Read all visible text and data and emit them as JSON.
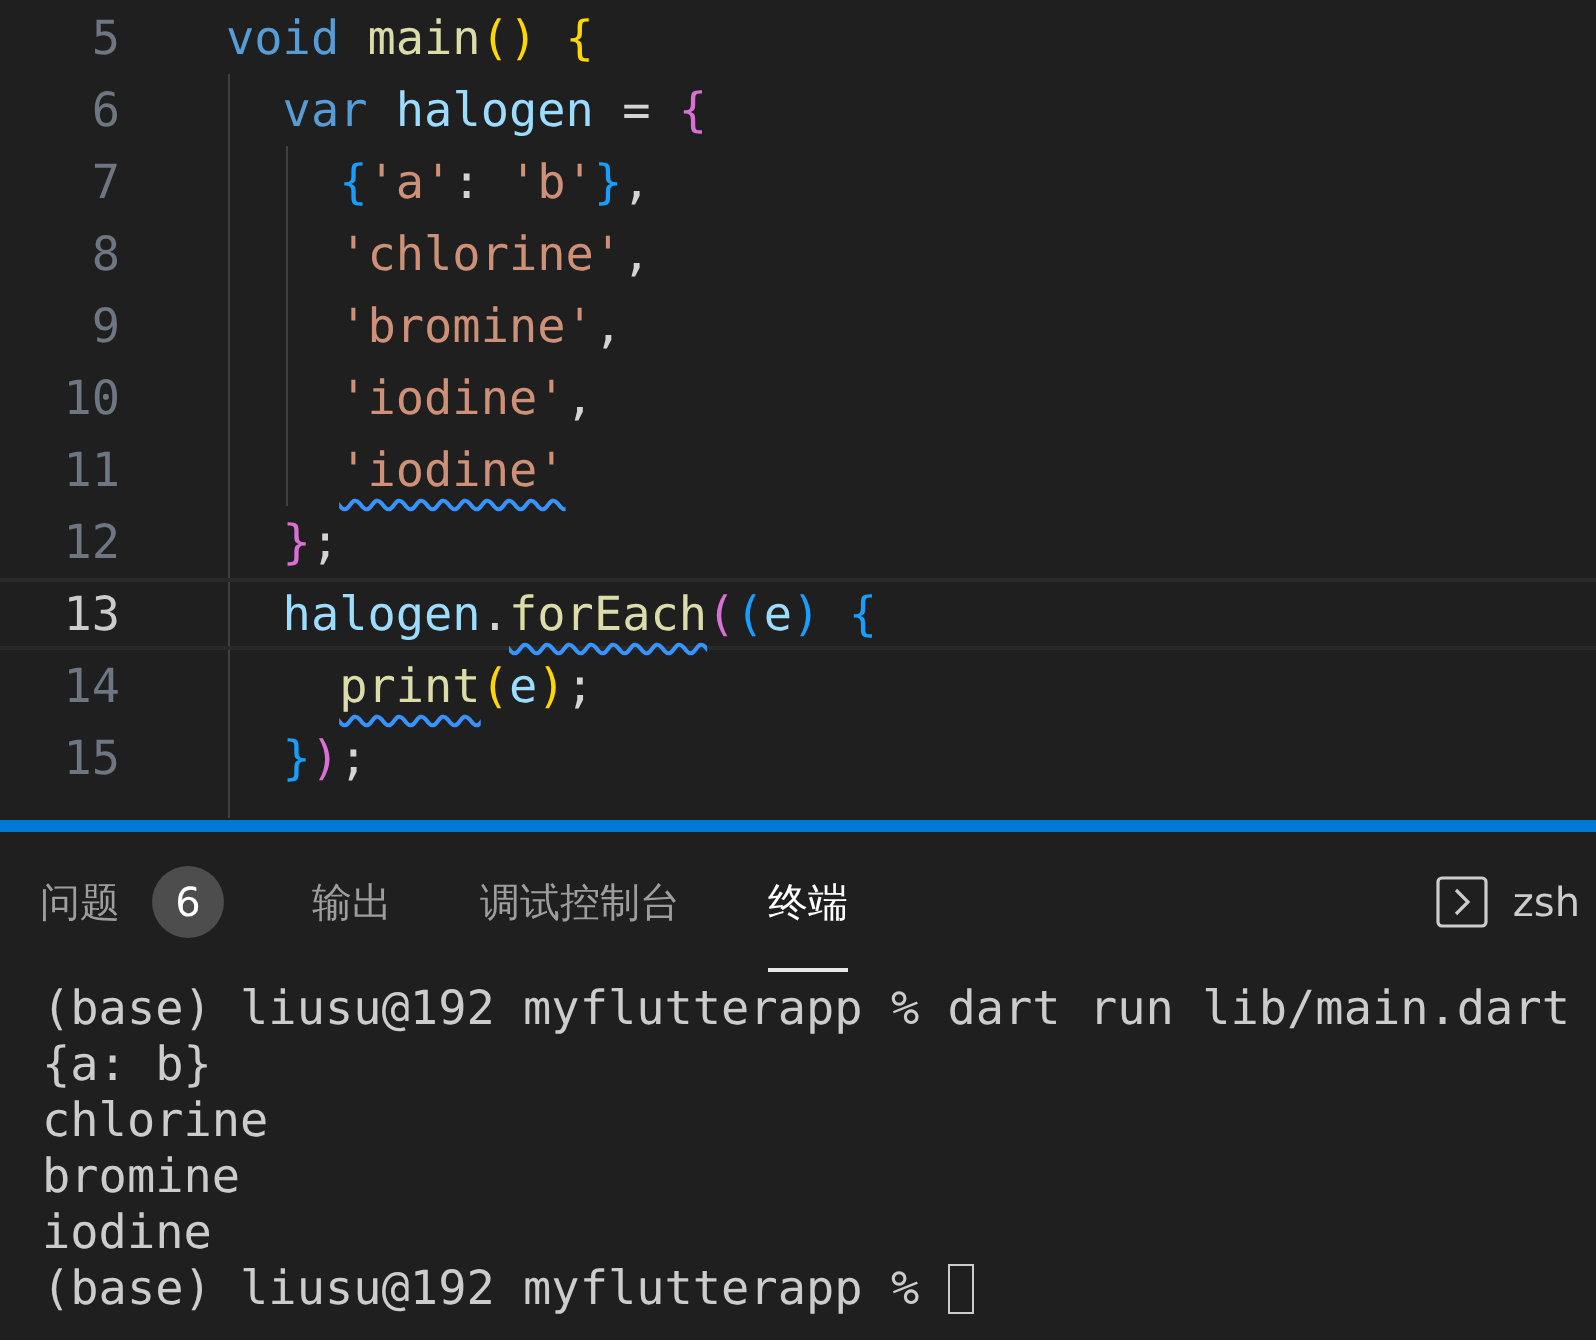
{
  "editor": {
    "lines": [
      {
        "number": "5",
        "current": false,
        "tokens": [
          {
            "text": "void",
            "kind": "keyword"
          },
          {
            "text": " main",
            "kind": "function"
          },
          {
            "text": "()",
            "kind": "bracket1"
          },
          {
            "text": " {",
            "kind": "bracket1"
          }
        ]
      },
      {
        "number": "6",
        "current": false,
        "tokens": [
          {
            "text": "  var",
            "kind": "keyword"
          },
          {
            "text": " halogen",
            "kind": "variable"
          },
          {
            "text": " = ",
            "kind": "punct"
          },
          {
            "text": "{",
            "kind": "bracket2"
          }
        ]
      },
      {
        "number": "7",
        "current": false,
        "tokens": [
          {
            "text": "    {",
            "kind": "bracket3"
          },
          {
            "text": "'a'",
            "kind": "string"
          },
          {
            "text": ": ",
            "kind": "punct"
          },
          {
            "text": "'b'",
            "kind": "string"
          },
          {
            "text": "}",
            "kind": "bracket3"
          },
          {
            "text": ",",
            "kind": "punct"
          }
        ]
      },
      {
        "number": "8",
        "current": false,
        "tokens": [
          {
            "text": "    'chlorine'",
            "kind": "string"
          },
          {
            "text": ",",
            "kind": "punct"
          }
        ]
      },
      {
        "number": "9",
        "current": false,
        "tokens": [
          {
            "text": "    'bromine'",
            "kind": "string"
          },
          {
            "text": ",",
            "kind": "punct"
          }
        ]
      },
      {
        "number": "10",
        "current": false,
        "tokens": [
          {
            "text": "    'iodine'",
            "kind": "string"
          },
          {
            "text": ",",
            "kind": "punct"
          }
        ]
      },
      {
        "number": "11",
        "current": false,
        "tokens": [
          {
            "text": "    'iodine'",
            "kind": "string",
            "warning": true
          }
        ]
      },
      {
        "number": "12",
        "current": false,
        "tokens": [
          {
            "text": "  }",
            "kind": "bracket2"
          },
          {
            "text": ";",
            "kind": "punct"
          }
        ]
      },
      {
        "number": "13",
        "current": true,
        "tokens": [
          {
            "text": "  halogen",
            "kind": "variable"
          },
          {
            "text": ".",
            "kind": "punct"
          },
          {
            "text": "forEach",
            "kind": "function",
            "warning": true
          },
          {
            "text": "(",
            "kind": "bracket2"
          },
          {
            "text": "(",
            "kind": "bracket3"
          },
          {
            "text": "e",
            "kind": "variable"
          },
          {
            "text": ")",
            "kind": "bracket3"
          },
          {
            "text": " {",
            "kind": "bracket3"
          }
        ]
      },
      {
        "number": "14",
        "current": false,
        "tokens": [
          {
            "text": "    print",
            "kind": "function",
            "warning": true
          },
          {
            "text": "(",
            "kind": "bracket1"
          },
          {
            "text": "e",
            "kind": "variable"
          },
          {
            "text": ")",
            "kind": "bracket1"
          },
          {
            "text": ";",
            "kind": "punct"
          }
        ]
      },
      {
        "number": "15",
        "current": false,
        "tokens": [
          {
            "text": "  }",
            "kind": "bracket3"
          },
          {
            "text": ")",
            "kind": "bracket2"
          },
          {
            "text": ";",
            "kind": "punct"
          }
        ]
      }
    ]
  },
  "panel": {
    "tabs": [
      {
        "label": "问题",
        "badge": "6",
        "selected": false
      },
      {
        "label": "输出",
        "selected": false
      },
      {
        "label": "调试控制台",
        "selected": false
      },
      {
        "label": "终端",
        "selected": true
      }
    ],
    "shell": "zsh",
    "terminal": {
      "lines": [
        "(base) liusu@192 myflutterapp % dart run lib/main.dart",
        "{a: b}",
        "chlorine",
        "bromine",
        "iodine",
        "(base) liusu@192 myflutterapp % "
      ]
    }
  }
}
